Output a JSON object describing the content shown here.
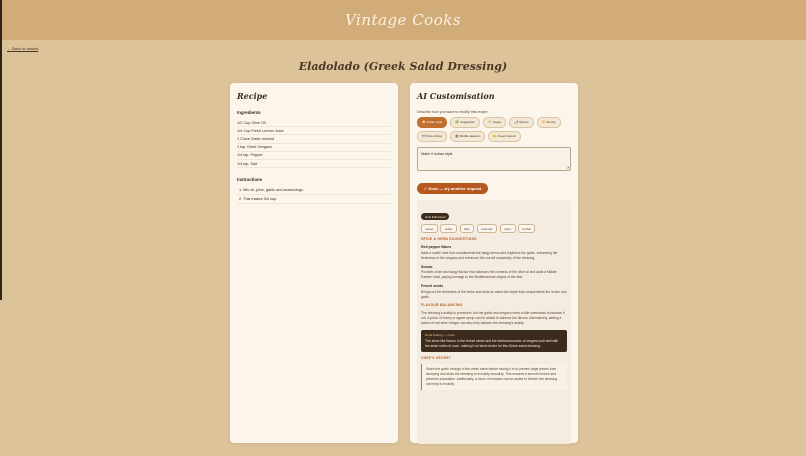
{
  "app": {
    "brand": "Vintage Cooks"
  },
  "nav": {
    "back_label": "← Back to results"
  },
  "page": {
    "title": "Eladolado (Greek Salad Dressing)"
  },
  "recipe": {
    "card_title": "Recipe",
    "ingredients_heading": "Ingredients",
    "ingredients": [
      "1/2 Cup Olive Oil",
      "1/4 Cup Fresh Lemon Juice",
      "1 Clove Garlic minced",
      "1 tsp. Dried Oregano",
      "1/4 tsp. Pepper",
      "1/4 tsp. Salt"
    ],
    "instructions_heading": "Instructions",
    "instructions": [
      "1. Mix oil, juice, garlic and seasonings.",
      "2. This makes 3/4 cup."
    ]
  },
  "ai": {
    "card_title": "AI Customisation",
    "description": "Describe how you want to modify this recipe:",
    "chips": [
      {
        "label": "🍛 Indian style",
        "active": true
      },
      {
        "label": "🌿 Vegetarian",
        "active": false
      },
      {
        "label": "🌱 Vegan",
        "active": false
      },
      {
        "label": "🌶 Spicier",
        "active": false
      },
      {
        "label": "🔆 Smoky",
        "active": false
      },
      {
        "label": "🍽 Fine dining",
        "active": false
      },
      {
        "label": "🏛 Middle Eastern",
        "active": false
      },
      {
        "label": "🍋 Keep historic",
        "active": false
      }
    ],
    "request_value": "Make it Indian style",
    "done_button": "✓ Done — try another request",
    "result": {
      "badge": "⊕ AI Enhanced",
      "tags": [
        "sweet",
        "acidic",
        "fatty",
        "aromatic",
        "spicy",
        "herbal"
      ],
      "spice_label": "SPICE & HERB SUGGESTIONS",
      "spices": [
        {
          "name": "Red pepper flakes",
          "desc": "Adds a subtle heat that complements the tangy lemon and brightens the garlic, enhancing the freshness of the oregano and enhances the overall complexity of the dressing."
        },
        {
          "name": "Sumac",
          "desc": "Provides a tart and tangy flavour that balances the richness of the olive oil and adds a Middle Eastern twist, paying homage to the Mediterranean origins of the dish."
        },
        {
          "name": "Fennel seeds",
          "desc": "Brings out the freshness of the herbs and adds an anise like depth that complements the lemon and garlic."
        }
      ],
      "balancing_label": "FLAVOUR BALANCING",
      "balancing_text": "The dressing's acidity is prominent, but the garlic and oregano need a little sweetness to balance it out. A pinch of honey or agave syrup can be added to balance the flavour. Alternatively, adding a splash of red wine vinegar can also help balance the dressing's acidity.",
      "pairing_heading": "Drink Pairing — Ouzo",
      "pairing_text": "The anise like flavour in the fennel seeds and the herbaceousness of oregano pair well with the anise notes of ouzo, making it an ideal choice for this Greek salad dressing.",
      "secret_label": "CHEF'S SECRET",
      "secret_text": "Strain the garlic through a fine-mesh sieve before mixing it in to prevent large pieces from clumping and allow the dressing to emulsify smoothly. This ensures a smooth texture and prevents separation. Additionally, a touch of mustard can be added to thicken the dressing and help it emulsify."
    }
  },
  "colors": {
    "accent": "#b6581f",
    "header": "#d2ac78",
    "background": "#dcc39a",
    "dark": "#3a2b1d"
  }
}
